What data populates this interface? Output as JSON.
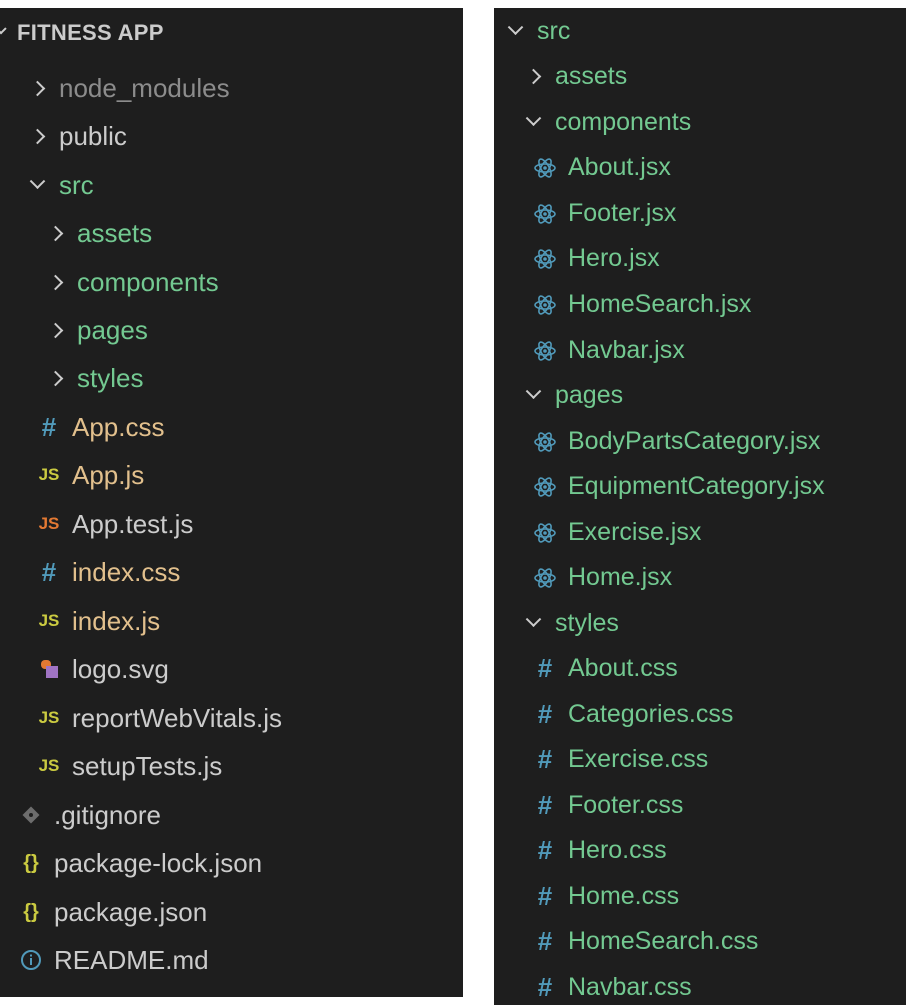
{
  "left_panel": {
    "root": {
      "label": "FITNESS APP"
    },
    "items": [
      {
        "label": "node_modules",
        "type": "folder",
        "state": "closed",
        "color": "#8c8c8c"
      },
      {
        "label": "public",
        "type": "folder",
        "state": "closed",
        "color": "#cccccc"
      },
      {
        "label": "src",
        "type": "folder",
        "state": "open",
        "color": "#73c991"
      },
      {
        "label": "assets",
        "type": "folder",
        "state": "closed",
        "color": "#73c991"
      },
      {
        "label": "components",
        "type": "folder",
        "state": "closed",
        "color": "#73c991"
      },
      {
        "label": "pages",
        "type": "folder",
        "state": "closed",
        "color": "#73c991"
      },
      {
        "label": "styles",
        "type": "folder",
        "state": "closed",
        "color": "#73c991"
      },
      {
        "label": "App.css",
        "type": "file",
        "icon": "css-hash-icon",
        "color": "#e2c08d"
      },
      {
        "label": "App.js",
        "type": "file",
        "icon": "js-icon",
        "color": "#e2c08d"
      },
      {
        "label": "App.test.js",
        "type": "file",
        "icon": "js-icon",
        "color": "#cccccc"
      },
      {
        "label": "index.css",
        "type": "file",
        "icon": "css-hash-icon",
        "color": "#e2c08d"
      },
      {
        "label": "index.js",
        "type": "file",
        "icon": "js-icon",
        "color": "#e2c08d"
      },
      {
        "label": "logo.svg",
        "type": "file",
        "icon": "svg-icon",
        "color": "#cccccc"
      },
      {
        "label": "reportWebVitals.js",
        "type": "file",
        "icon": "js-icon",
        "color": "#cccccc"
      },
      {
        "label": "setupTests.js",
        "type": "file",
        "icon": "js-icon",
        "color": "#cccccc"
      },
      {
        "label": ".gitignore",
        "type": "file",
        "icon": "git-icon",
        "color": "#cccccc"
      },
      {
        "label": "package-lock.json",
        "type": "file",
        "icon": "json-braces-icon",
        "color": "#cccccc"
      },
      {
        "label": "package.json",
        "type": "file",
        "icon": "json-braces-icon",
        "color": "#cccccc"
      },
      {
        "label": "README.md",
        "type": "file",
        "icon": "info-icon",
        "color": "#cccccc"
      }
    ]
  },
  "right_panel": {
    "items": [
      {
        "label": "src",
        "type": "folder",
        "state": "open"
      },
      {
        "label": "assets",
        "type": "folder",
        "state": "closed"
      },
      {
        "label": "components",
        "type": "folder",
        "state": "open"
      },
      {
        "label": "About.jsx",
        "type": "file",
        "icon": "react-icon"
      },
      {
        "label": "Footer.jsx",
        "type": "file",
        "icon": "react-icon"
      },
      {
        "label": "Hero.jsx",
        "type": "file",
        "icon": "react-icon"
      },
      {
        "label": "HomeSearch.jsx",
        "type": "file",
        "icon": "react-icon"
      },
      {
        "label": "Navbar.jsx",
        "type": "file",
        "icon": "react-icon"
      },
      {
        "label": "pages",
        "type": "folder",
        "state": "open"
      },
      {
        "label": "BodyPartsCategory.jsx",
        "type": "file",
        "icon": "react-icon"
      },
      {
        "label": "EquipmentCategory.jsx",
        "type": "file",
        "icon": "react-icon"
      },
      {
        "label": "Exercise.jsx",
        "type": "file",
        "icon": "react-icon"
      },
      {
        "label": "Home.jsx",
        "type": "file",
        "icon": "react-icon"
      },
      {
        "label": "styles",
        "type": "folder",
        "state": "open"
      },
      {
        "label": "About.css",
        "type": "file",
        "icon": "css-hash-icon"
      },
      {
        "label": "Categories.css",
        "type": "file",
        "icon": "css-hash-icon"
      },
      {
        "label": "Exercise.css",
        "type": "file",
        "icon": "css-hash-icon"
      },
      {
        "label": "Footer.css",
        "type": "file",
        "icon": "css-hash-icon"
      },
      {
        "label": "Hero.css",
        "type": "file",
        "icon": "css-hash-icon"
      },
      {
        "label": "Home.css",
        "type": "file",
        "icon": "css-hash-icon"
      },
      {
        "label": "HomeSearch.css",
        "type": "file",
        "icon": "css-hash-icon"
      },
      {
        "label": "Navbar.css",
        "type": "file",
        "icon": "css-hash-icon"
      }
    ]
  },
  "colors": {
    "background": "#1e1e1e",
    "untracked_green": "#73c991",
    "modified_yellow": "#e2c08d",
    "ignored_gray": "#8c8c8c",
    "default_text": "#cccccc",
    "css_icon_blue": "#519aba",
    "js_icon_yellow": "#cbcb41",
    "react_icon_blue": "#519aba"
  }
}
